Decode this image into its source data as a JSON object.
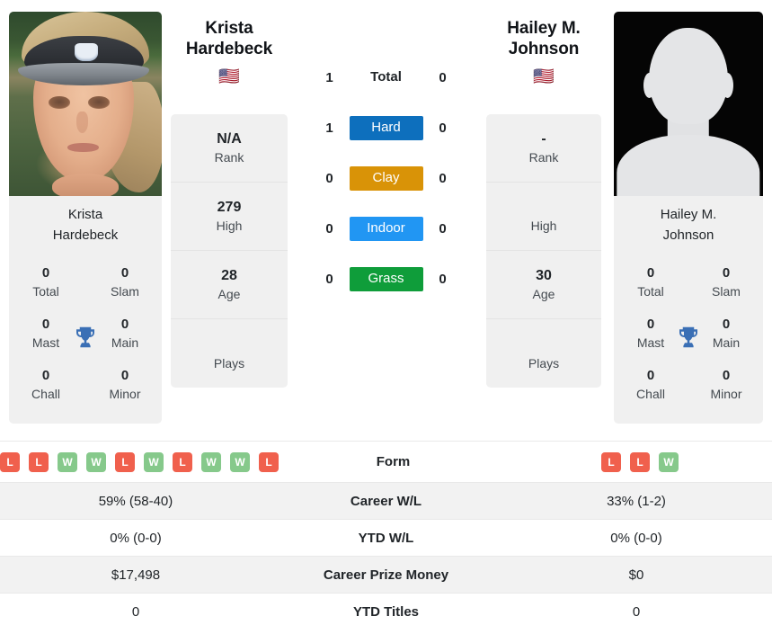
{
  "players": {
    "left": {
      "name": "Krista Hardebeck",
      "name_line1": "Krista",
      "name_line2": "Hardebeck",
      "flag": "🇺🇸",
      "photo_type": "portrait-photo",
      "caption_line1": "Krista",
      "caption_line2": "Hardebeck",
      "rank": "N/A",
      "rank_label": "Rank",
      "high": "279",
      "high_label": "High",
      "age": "28",
      "age_label": "Age",
      "plays": "",
      "plays_label": "Plays",
      "titles": {
        "total": "0",
        "total_label": "Total",
        "slam": "0",
        "slam_label": "Slam",
        "mast": "0",
        "mast_label": "Mast",
        "main": "0",
        "main_label": "Main",
        "chall": "0",
        "chall_label": "Chall",
        "minor": "0",
        "minor_label": "Minor"
      },
      "form": [
        "L",
        "L",
        "W",
        "W",
        "L",
        "W",
        "L",
        "W",
        "W",
        "L"
      ],
      "career_wl": "59% (58-40)",
      "ytd_wl": "0% (0-0)",
      "career_prize": "$17,498",
      "ytd_titles": "0"
    },
    "right": {
      "name": "Hailey M. Johnson",
      "name_line1": "Hailey M.",
      "name_line2": "Johnson",
      "flag": "🇺🇸",
      "photo_type": "placeholder-silhouette",
      "caption_line1": "Hailey M.",
      "caption_line2": "Johnson",
      "rank": "-",
      "rank_label": "Rank",
      "high": "",
      "high_label": "High",
      "age": "30",
      "age_label": "Age",
      "plays": "",
      "plays_label": "Plays",
      "titles": {
        "total": "0",
        "total_label": "Total",
        "slam": "0",
        "slam_label": "Slam",
        "mast": "0",
        "mast_label": "Mast",
        "main": "0",
        "main_label": "Main",
        "chall": "0",
        "chall_label": "Chall",
        "minor": "0",
        "minor_label": "Minor"
      },
      "form": [
        "L",
        "L",
        "W"
      ],
      "career_wl": "33% (1-2)",
      "ytd_wl": "0% (0-0)",
      "career_prize": "$0",
      "ytd_titles": "0"
    }
  },
  "h2h": [
    {
      "label": "Total",
      "left": "1",
      "right": "0",
      "color": "",
      "plain": true
    },
    {
      "label": "Hard",
      "left": "1",
      "right": "0",
      "color": "#0d6fbd",
      "plain": false
    },
    {
      "label": "Clay",
      "left": "0",
      "right": "0",
      "color": "#d99307",
      "plain": false
    },
    {
      "label": "Indoor",
      "left": "0",
      "right": "0",
      "color": "#2196f3",
      "plain": false
    },
    {
      "label": "Grass",
      "left": "0",
      "right": "0",
      "color": "#0f9d3a",
      "plain": false
    }
  ],
  "stats_rows": [
    {
      "label": "Form",
      "left": "",
      "right": "",
      "is_form": true,
      "shaded": false
    },
    {
      "label": "Career W/L",
      "left": "59% (58-40)",
      "right": "33% (1-2)",
      "is_form": false,
      "shaded": true
    },
    {
      "label": "YTD W/L",
      "left": "0% (0-0)",
      "right": "0% (0-0)",
      "is_form": false,
      "shaded": false
    },
    {
      "label": "Career Prize Money",
      "left": "$17,498",
      "right": "$0",
      "is_form": false,
      "shaded": true
    },
    {
      "label": "YTD Titles",
      "left": "0",
      "right": "0",
      "is_form": false,
      "shaded": false
    }
  ],
  "colors": {
    "hard": "#0d6fbd",
    "clay": "#d99307",
    "indoor": "#2196f3",
    "grass": "#0f9d3a",
    "win": "#86c98b",
    "loss": "#f0604d",
    "card_bg": "#f0f0f0",
    "row_shade": "#f2f2f2",
    "trophy": "#3a6fb5"
  }
}
